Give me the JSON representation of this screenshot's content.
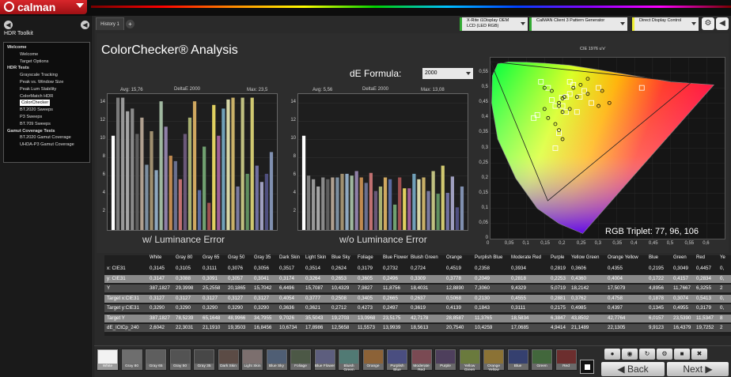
{
  "app": {
    "name": "calman"
  },
  "sidebar": {
    "title": "HDR Toolkit",
    "tree": [
      {
        "label": "Welcome",
        "level": 0,
        "header": true
      },
      {
        "label": "Welcome",
        "level": 1
      },
      {
        "label": "Target Options",
        "level": 1
      },
      {
        "label": "HDR Tests",
        "level": 0,
        "header": true
      },
      {
        "label": "Grayscale Tracking",
        "level": 1
      },
      {
        "label": "Peak vs. Window Size",
        "level": 1
      },
      {
        "label": "Peak Lum Stability",
        "level": 1
      },
      {
        "label": "ColorMatch HDR",
        "level": 1
      },
      {
        "label": "ColorChecker",
        "level": 1,
        "selected": true
      },
      {
        "label": "BT.2020 Sweeps",
        "level": 1
      },
      {
        "label": "P3 Sweeps",
        "level": 1
      },
      {
        "label": "BT.709 Sweeps",
        "level": 1
      },
      {
        "label": "Gamut Coverage Tests",
        "level": 0,
        "header": true
      },
      {
        "label": "BT.2020 Gamut Coverage",
        "level": 1
      },
      {
        "label": "UHDA-P3 Gamut Coverage",
        "level": 1
      }
    ]
  },
  "tabs": [
    {
      "label": "History 1"
    }
  ],
  "devices": {
    "meter": "X-Rite i1Display OEM\nLCD (LED RGB)",
    "generator": "CalMAN Client 3 Pattern Generator",
    "display": "Direct Display Control"
  },
  "page": {
    "title": "ColorChecker® Analysis",
    "formula_label": "dE Formula:",
    "formula_value": "2000",
    "rgb_triplet": "RGB Triplet: 77, 96, 106"
  },
  "chart_data": [
    {
      "type": "bar",
      "label": "w/ Luminance Error",
      "metric": "DeltaE 2000",
      "avg": "Avg: 15,76",
      "max": "Max: 23,5",
      "ylim": [
        0,
        15
      ],
      "yticks": [
        "14",
        "12",
        "10",
        "8",
        "6",
        "4",
        "2"
      ],
      "values": [
        10.4,
        14.6,
        14.6,
        13.1,
        13.4,
        10.6,
        12.4,
        7.2,
        10.9,
        6.6,
        14.2,
        11.4,
        8.2,
        7.6,
        5.6,
        10.6,
        12.4,
        14.2,
        4.4,
        9.2,
        3.0,
        13.8,
        10.4,
        13.4,
        14.4,
        14.6,
        4.8,
        14.6,
        6.2,
        14.6,
        7.1,
        5.3,
        6.2,
        8.6
      ],
      "colors": [
        "#ffffff",
        "#7b7b7b",
        "#989898",
        "#a6a6a6",
        "#8a8a8a",
        "#5e5e5e",
        "#b0a090",
        "#7d8fa0",
        "#a09070",
        "#8fa8c0",
        "#a0b8a0",
        "#9080a8",
        "#c08a50",
        "#6a7090",
        "#c07070",
        "#6a5878",
        "#a8b070",
        "#d0a860",
        "#5a6aa0",
        "#70a070",
        "#a05050",
        "#e0d060",
        "#a06098",
        "#70a0b8",
        "#d8d8a8",
        "#c8b068",
        "#7a7aa0",
        "#c0c080",
        "#609060",
        "#d0c870",
        "#7070a0",
        "#a0a0c0",
        "#505080",
        "#8090b0"
      ]
    },
    {
      "type": "bar",
      "label": "w/o Luminance Error",
      "metric": "DeltaE 2000",
      "avg": "Avg: 5,56",
      "max": "Max: 13,08",
      "ylim": [
        0,
        15
      ],
      "yticks": [
        "14",
        "12",
        "10",
        "8",
        "6",
        "4",
        "2"
      ],
      "values": [
        10.4,
        6.0,
        5.6,
        4.8,
        5.8,
        5.6,
        5.8,
        5.8,
        6.2,
        6.2,
        6.0,
        6.5,
        5.8,
        5.2,
        6.3,
        4.3,
        4.8,
        5.8,
        5.6,
        2.8,
        5.8,
        4.6,
        4.6,
        6.2,
        5.6,
        5.8,
        4.3,
        6.5,
        4.0,
        7.1,
        4.1,
        5.9,
        2.5,
        4.8
      ],
      "colors": [
        "#ffffff",
        "#7b7b7b",
        "#989898",
        "#a6a6a6",
        "#8a8a8a",
        "#5e5e5e",
        "#b0a090",
        "#7d8fa0",
        "#a09070",
        "#8fa8c0",
        "#a0b8a0",
        "#9080a8",
        "#c08a50",
        "#6a7090",
        "#c07070",
        "#6a5878",
        "#a8b070",
        "#d0a860",
        "#5a6aa0",
        "#70a070",
        "#a05050",
        "#e0d060",
        "#a06098",
        "#70a0b8",
        "#d8d8a8",
        "#c8b068",
        "#7a7aa0",
        "#c0c080",
        "#609060",
        "#d0c870",
        "#7070a0",
        "#a0a0c0",
        "#505080",
        "#8090b0"
      ]
    },
    {
      "type": "scatter",
      "title": "CIE 1976 u'v'",
      "xlim": [
        0,
        0.65
      ],
      "ylim": [
        0,
        0.6
      ],
      "xticks": [
        "0",
        "0,05",
        "0,1",
        "0,15",
        "0,2",
        "0,25",
        "0,3",
        "0,35",
        "0,4",
        "0,45",
        "0,5",
        "0,55",
        "0,6"
      ],
      "yticks": [
        "0,55",
        "0,5",
        "0,45",
        "0,4",
        "0,35",
        "0,3",
        "0,25",
        "0,2",
        "0,15",
        "0,1",
        "0,05",
        "0"
      ],
      "targets": [
        [
          0.198,
          0.468
        ],
        [
          0.21,
          0.47
        ],
        [
          0.248,
          0.47
        ],
        [
          0.18,
          0.44
        ],
        [
          0.26,
          0.49
        ],
        [
          0.16,
          0.5
        ],
        [
          0.3,
          0.5
        ],
        [
          0.14,
          0.52
        ],
        [
          0.22,
          0.52
        ],
        [
          0.28,
          0.45
        ],
        [
          0.42,
          0.5
        ],
        [
          0.24,
          0.42
        ],
        [
          0.13,
          0.41
        ],
        [
          0.12,
          0.4
        ],
        [
          0.23,
          0.51
        ],
        [
          0.19,
          0.35
        ],
        [
          0.18,
          0.3
        ],
        [
          0.22,
          0.48
        ],
        [
          0.2,
          0.44
        ],
        [
          0.21,
          0.42
        ],
        [
          0.17,
          0.46
        ]
      ],
      "measured": [
        [
          0.2,
          0.465
        ],
        [
          0.205,
          0.47
        ],
        [
          0.27,
          0.48
        ],
        [
          0.19,
          0.44
        ],
        [
          0.25,
          0.51
        ],
        [
          0.17,
          0.49
        ],
        [
          0.31,
          0.49
        ],
        [
          0.15,
          0.5
        ],
        [
          0.23,
          0.5
        ],
        [
          0.3,
          0.44
        ],
        [
          0.33,
          0.45
        ],
        [
          0.22,
          0.43
        ],
        [
          0.15,
          0.43
        ],
        [
          0.18,
          0.38
        ],
        [
          0.27,
          0.53
        ],
        [
          0.19,
          0.36
        ],
        [
          0.2,
          0.33
        ],
        [
          0.24,
          0.47
        ],
        [
          0.19,
          0.45
        ],
        [
          0.2,
          0.42
        ],
        [
          0.16,
          0.4
        ]
      ]
    }
  ],
  "table": {
    "columns": [
      "",
      "White",
      "Gray 80",
      "Gray 65",
      "Gray 50",
      "Gray 35",
      "Dark Skin",
      "Light Skin",
      "Blue Sky",
      "Foliage",
      "Blue Flower",
      "Bluish Green",
      "Orange",
      "Purplish Blue",
      "Moderate Red",
      "Purple",
      "Yellow Green",
      "Orange Yellow",
      "Blue",
      "Green",
      "Red",
      "Ye"
    ],
    "rows": [
      [
        "x: CIE31",
        "0,3145",
        "0,3105",
        "0,3111",
        "0,3076",
        "0,3056",
        "0,3517",
        "0,3514",
        "0,2624",
        "0,3179",
        "0,2732",
        "0,2724",
        "0,4519",
        "0,2358",
        "0,3934",
        "0,2819",
        "0,3606",
        "0,4355",
        "0,2195",
        "0,3049",
        "0,4457",
        "0,"
      ],
      [
        "y: CIE31",
        "0,3147",
        "0,3088",
        "0,3091",
        "0,3057",
        "0,3041",
        "0,3174",
        "0,3264",
        "0,2653",
        "0,3605",
        "0,2496",
        "0,3309",
        "0,3778",
        "0,2049",
        "0,2818",
        "0,2253",
        "0,4360",
        "0,4004",
        "0,1722",
        "0,4157",
        "0,2834",
        "0,"
      ],
      [
        "Y",
        "387,1827",
        "29,3998",
        "25,2558",
        "20,1865",
        "15,7042",
        "6,4496",
        "15,7087",
        "10,4329",
        "7,9827",
        "11,8756",
        "18,4031",
        "12,8890",
        "7,3060",
        "9,4329",
        "5,0719",
        "18,2142",
        "17,5079",
        "4,8956",
        "11,7667",
        "6,3255",
        "2"
      ],
      [
        "Target x:CIE31",
        "0,3127",
        "0,3127",
        "0,3127",
        "0,3127",
        "0,3127",
        "0,4054",
        "0,3777",
        "0,2508",
        "0,3405",
        "0,2665",
        "0,2637",
        "0,5068",
        "0,2130",
        "0,4555",
        "0,2881",
        "0,3762",
        "0,4758",
        "0,1878",
        "0,3074",
        "0,5413",
        "0,"
      ],
      [
        "Target y:CIE31",
        "0,3290",
        "0,3290",
        "0,3290",
        "0,3290",
        "0,3290",
        "0,3636",
        "0,3621",
        "0,2712",
        "0,4273",
        "0,2497",
        "0,3619",
        "0,4139",
        "0,1843",
        "0,3111",
        "0,2175",
        "0,4985",
        "0,4397",
        "0,1345",
        "0,4955",
        "0,3179",
        "0,"
      ],
      [
        "Target Y",
        "387,1827",
        "78,5239",
        "65,1648",
        "48,9966",
        "34,7955",
        "9,7026",
        "35,5043",
        "19,2703",
        "13,0968",
        "23,5175",
        "42,7178",
        "28,8587",
        "11,3765",
        "18,5834",
        "6,3847",
        "43,8502",
        "42,7764",
        "6,0157",
        "23,5390",
        "11,5347",
        "8"
      ],
      [
        "dE_ICtCp_240",
        "2,6042",
        "22,3031",
        "21,1910",
        "19,3503",
        "16,8456",
        "10,6734",
        "17,8986",
        "12,5658",
        "11,5573",
        "13,9939",
        "18,5613",
        "20,7540",
        "10,4259",
        "17,0685",
        "4,9414",
        "21,1489",
        "22,1305",
        "9,9123",
        "16,4379",
        "19,7252",
        "2"
      ]
    ]
  },
  "swatches": [
    {
      "label": "White",
      "color": "#f2f2f2",
      "selected": true
    },
    {
      "label": "Gray 80",
      "color": "#6e6e6e"
    },
    {
      "label": "Gray 65",
      "color": "#5e5e5e"
    },
    {
      "label": "Gray 50",
      "color": "#535353"
    },
    {
      "label": "Gray 35",
      "color": "#474747"
    },
    {
      "label": "Dark Skin",
      "color": "#5b4b45"
    },
    {
      "label": "Light Skin",
      "color": "#7c6f6e"
    },
    {
      "label": "Blue Sky",
      "color": "#4f5e74"
    },
    {
      "label": "Foliage",
      "color": "#4c5846"
    },
    {
      "label": "Blue Flower",
      "color": "#5d5e7e"
    },
    {
      "label": "Bluish Green",
      "color": "#517a74"
    },
    {
      "label": "Orange",
      "color": "#8c6237"
    },
    {
      "label": "Purplish Blue",
      "color": "#4a4e80"
    },
    {
      "label": "Moderate Red",
      "color": "#7a4a53"
    },
    {
      "label": "Purple",
      "color": "#4e3f5c"
    },
    {
      "label": "Yellow Green",
      "color": "#6a7a3d"
    },
    {
      "label": "Orange Yellow",
      "color": "#8b7235"
    },
    {
      "label": "Blue",
      "color": "#35406f"
    },
    {
      "label": "Green",
      "color": "#42673c"
    },
    {
      "label": "Red",
      "color": "#6c2e2e"
    }
  ],
  "nav": {
    "back": "Back",
    "next": "Next"
  }
}
